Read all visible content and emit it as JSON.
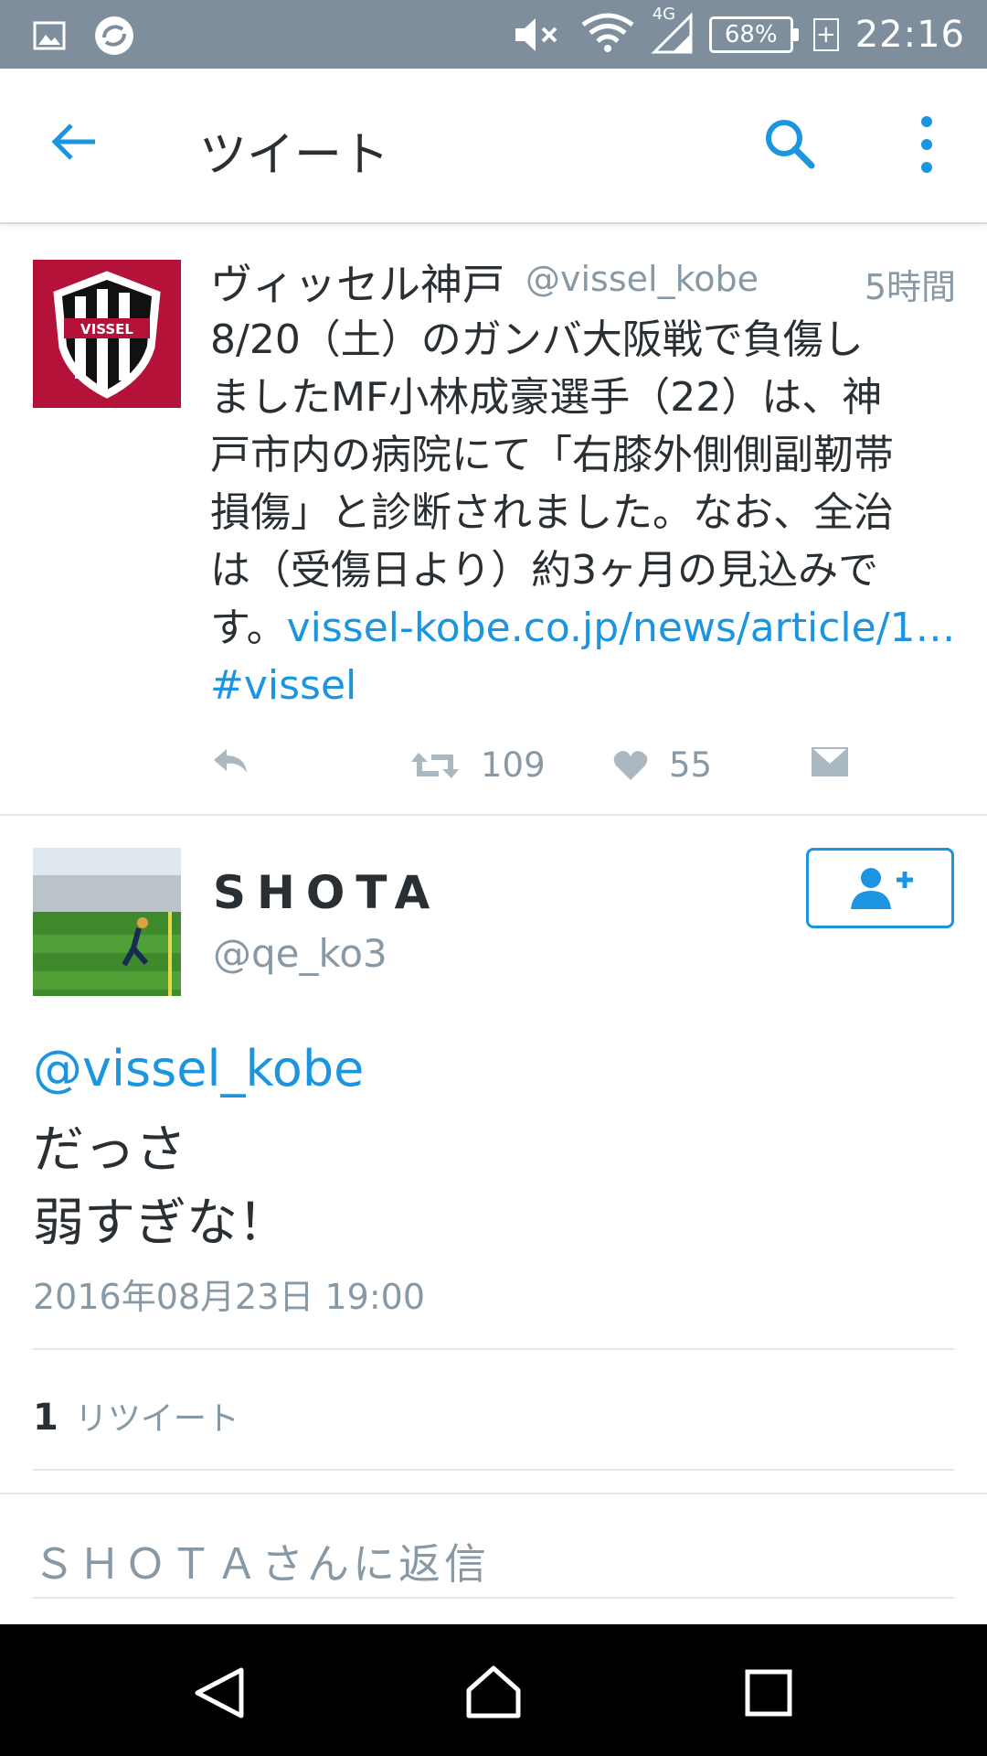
{
  "status_bar": {
    "time": "22:16",
    "battery": "68%",
    "network": "4G",
    "icons": [
      "image-icon",
      "sync-app-icon",
      "mute-icon",
      "wifi-icon",
      "signal-icon",
      "battery-icon",
      "charging-icon"
    ]
  },
  "app_bar": {
    "title": "ツイート",
    "icons": [
      "back-arrow-icon",
      "search-icon",
      "more-vert-icon"
    ]
  },
  "tweet": {
    "name": "ヴィッセル神戸",
    "handle": "@vissel_kobe",
    "time": "5時間",
    "avatar_text": "VISSEL",
    "body_lines": [
      "8/20（土）のガンバ大阪戦で負傷し",
      "ましたMF小林成豪選手（22）は、神",
      "戸市内の病院にて「右膝外側側副靭帯",
      "損傷」と診断されました。なお、全治",
      "は（受傷日より）約3ヶ月の見込みで"
    ],
    "body_last_prefix": "す。",
    "link": "vissel-kobe.co.jp/news/article/1…",
    "hashtag": "#vissel",
    "retweet_count": "109",
    "like_count": "55"
  },
  "reply_tweet": {
    "name": "SHOTA",
    "handle": "@qe_ko3",
    "mention": "@vissel_kobe",
    "lines": [
      "だっさ",
      "弱すぎな！"
    ],
    "date": "2016年08月23日 19:00",
    "retweets_num": "1",
    "retweets_label": "リツイート"
  },
  "reply_input": {
    "placeholder": "ＳＨＯＴＡさんに返信"
  },
  "colors": {
    "status_bar": "#7e8e9c",
    "accent": "#1b95e0",
    "text": "#292f33",
    "muted": "#8899a6",
    "vissel_red": "#b5123a"
  }
}
